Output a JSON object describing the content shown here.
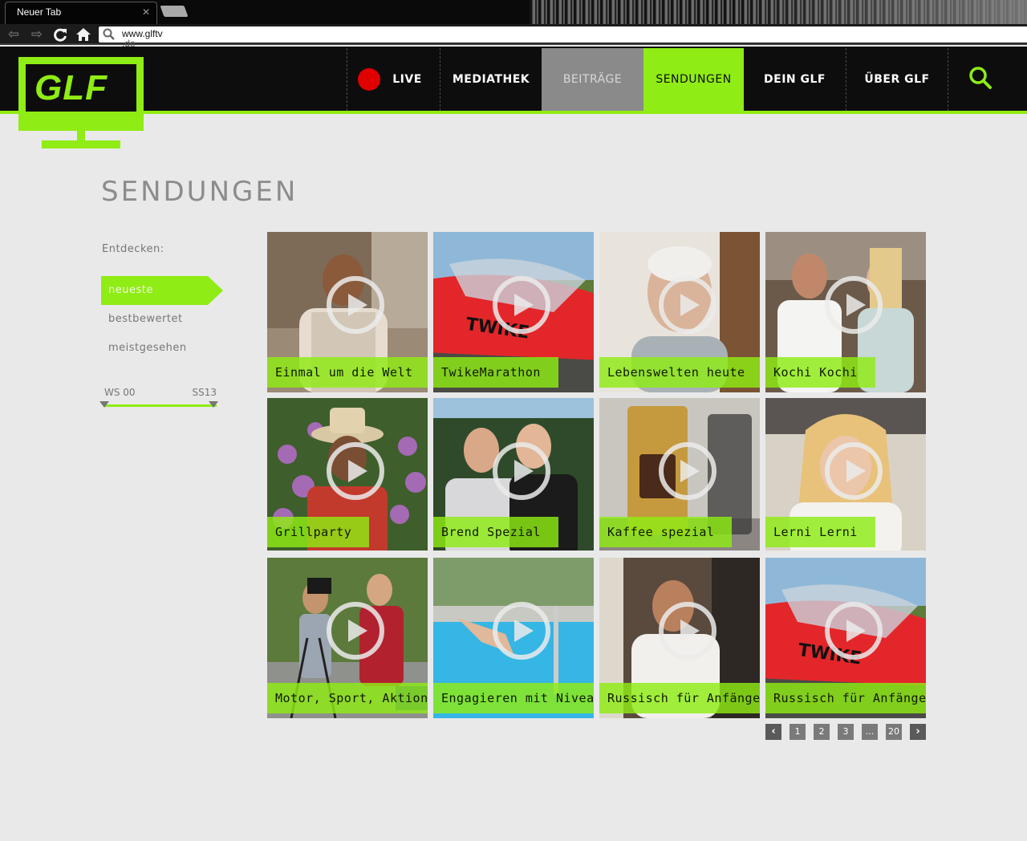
{
  "browser": {
    "tab_title": "Neuer Tab",
    "tab_close": "✕",
    "url_line1": "www.glftv",
    "url_line2": ".de"
  },
  "header": {
    "logo_text": "GLF",
    "nav": [
      {
        "label": "LIVE"
      },
      {
        "label": "MEDIATHEK"
      },
      {
        "label": "BEITRÄGE"
      },
      {
        "label": "SENDUNGEN"
      },
      {
        "label": "DEIN GLF"
      },
      {
        "label": "ÜBER GLF"
      }
    ]
  },
  "colors": {
    "accent": "#8fec14",
    "live": "#e00000",
    "header_bg": "#0d0d0d",
    "page_bg": "#e9e9e9"
  },
  "page": {
    "title": "SENDUNGEN"
  },
  "sidebar": {
    "discover_label": "Entdecken:",
    "filters": [
      {
        "label": "neueste",
        "active": true
      },
      {
        "label": "bestbewertet",
        "active": false
      },
      {
        "label": "meistgesehen",
        "active": false
      }
    ],
    "range": {
      "from": "WS 00",
      "to": "SS13"
    }
  },
  "shows": [
    {
      "title": "Einmal um die Welt",
      "scene": "man-indoor"
    },
    {
      "title": "TwikeMarathon",
      "scene": "red-vehicle"
    },
    {
      "title": "Lebenswelten heute",
      "scene": "old-man"
    },
    {
      "title": "Kochi Kochi",
      "scene": "two-people"
    },
    {
      "title": "Grillparty",
      "scene": "flowers-hat"
    },
    {
      "title": "Brend Spezial",
      "scene": "two-men-forest"
    },
    {
      "title": "Kaffee spezial",
      "scene": "coffee"
    },
    {
      "title": "Lerni Lerni",
      "scene": "woman-desk"
    },
    {
      "title": "Motor, Sport, Aktion",
      "scene": "camera-biker"
    },
    {
      "title": "Engagieren mit Niveau",
      "scene": "pool"
    },
    {
      "title": "Russisch für Anfänger",
      "scene": "man-indoor-2"
    },
    {
      "title": "Russisch für Anfänger",
      "scene": "red-vehicle"
    }
  ],
  "pagination": {
    "prev": "‹",
    "pages": [
      "1",
      "2",
      "3",
      "...",
      "20"
    ],
    "next": "›"
  }
}
